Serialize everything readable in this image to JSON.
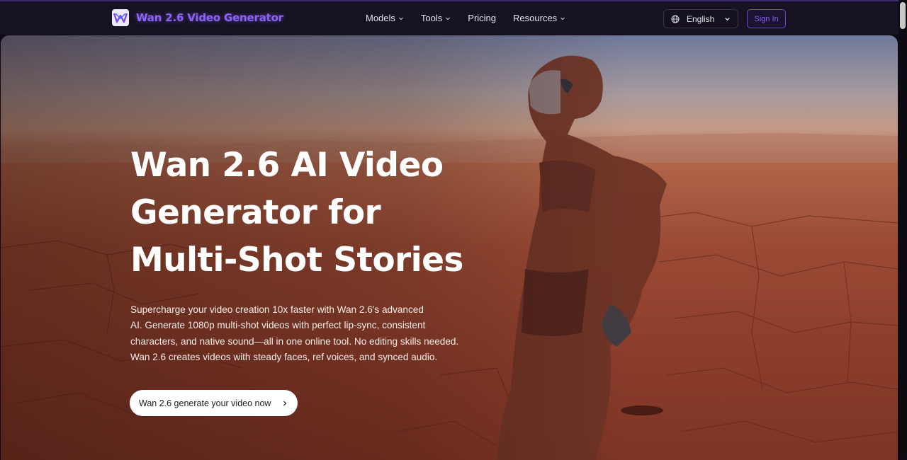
{
  "header": {
    "brand_name": "Wan 2.6 Video Generator",
    "logo_icon": "wan-logo-icon",
    "nav": [
      {
        "label": "Models",
        "has_dropdown": true
      },
      {
        "label": "Tools",
        "has_dropdown": true
      },
      {
        "label": "Pricing",
        "has_dropdown": false
      },
      {
        "label": "Resources",
        "has_dropdown": true
      }
    ],
    "language": {
      "label": "English",
      "icon": "globe-icon"
    },
    "signin_label": "Sign In"
  },
  "hero": {
    "title_lines": [
      "Wan 2.6 AI Video",
      "Generator for",
      "Multi-Shot Stories"
    ],
    "description_lines": [
      "Supercharge your video creation 10x faster with Wan 2.6's advanced",
      "AI. Generate 1080p multi-shot videos with perfect lip-sync, consistent",
      "characters, and native sound—all in one online tool. No editing skills needed.",
      "Wan 2.6 creates videos with steady faces, ref voices, and synced audio."
    ],
    "cta_label": "Wan 2.6 generate your video now",
    "background": "astronaut-on-cracked-desert-image"
  },
  "colors": {
    "accent": "#8d63f5",
    "topbar_bg": "#161222",
    "cta_bg": "#ffffff"
  }
}
